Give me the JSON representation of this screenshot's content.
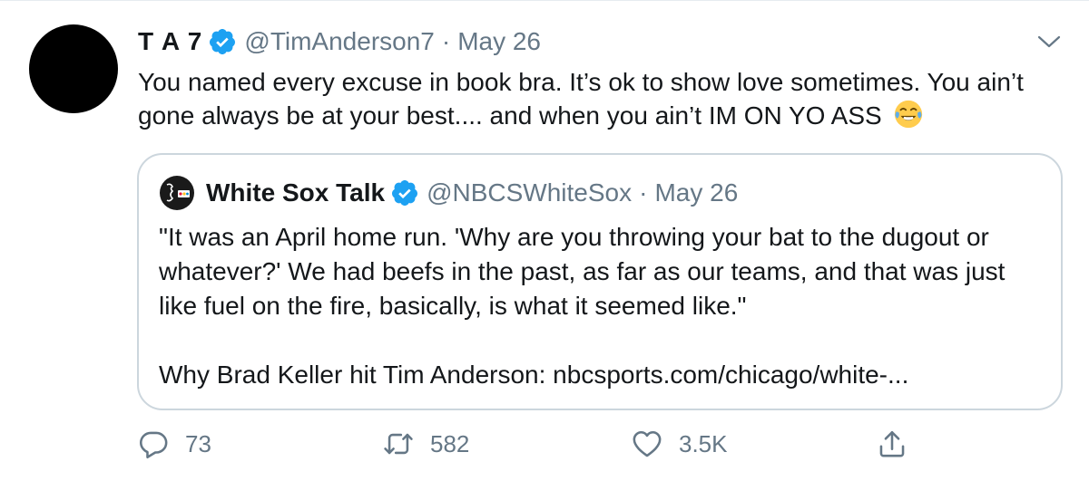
{
  "tweet": {
    "display_name": "T A 7",
    "handle": "@TimAnderson7",
    "separator": "·",
    "date": "May 26",
    "text": "You named every excuse in book bra. It’s ok to show love sometimes. You ain’t gone always be at your best.... and when you ain’t IM ON YO ASS",
    "emoji_icon": "face-with-tears-of-joy-emoji",
    "verified_icon": "verified-badge-icon",
    "caret_icon": "chevron-down-icon"
  },
  "quoted_tweet": {
    "display_name": "White Sox Talk",
    "handle": "@NBCSWhiteSox",
    "separator": "·",
    "date": "May 26",
    "text": "\"It was an April home run. 'Why are you throwing your bat to the dugout or whatever?' We had beefs in the past, as far as our teams, and that was just like fuel on the fire, basically, is what it seemed like.\"",
    "link_text": "Why Brad Keller hit Tim Anderson: nbcsports.com/chicago/white-..."
  },
  "actions": {
    "reply_count": "73",
    "retweet_count": "582",
    "like_count": "3.5K"
  },
  "colors": {
    "text": "#14171a",
    "secondary": "#657786",
    "verified_blue": "#1da1f2",
    "border": "#ccd6dd"
  }
}
